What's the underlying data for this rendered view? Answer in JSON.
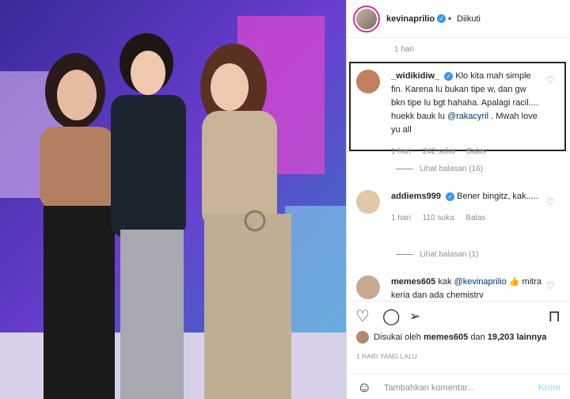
{
  "post": {
    "username": "kevinaprilio",
    "follow_status": "Diikuti",
    "dot": "•",
    "time_ago": "1 hari"
  },
  "comments": [
    {
      "username": "_widikidiw_",
      "text_before": "Klo kita mah simple fin. Karena lu bukan tipe w, dan gw bkn tipe lu bgt hahaha. Apalagi racil.... huekk bauk lu ",
      "mention": "@rakacyril",
      "text_after": " . Mwah love yu all",
      "time": "1 hari",
      "likes": "242 suka",
      "reply": "Balas",
      "view_replies": "Lihat balasan (16)"
    },
    {
      "username": "addiems999",
      "text_before": "Bener bingitz, kak.....",
      "time": "1 hari",
      "likes": "110 suka",
      "reply": "Balas",
      "view_replies": "Lihat balasan (1)"
    },
    {
      "username": "memes605",
      "text_before": "kak ",
      "mention": "@kevinaprilio",
      "text_after": " 👍 mitra keria dan ada chemistrv"
    }
  ],
  "liked_by": {
    "prefix": "Disukai oleh",
    "user": "memes605",
    "conj": "dan",
    "count": "19,203 lainnya"
  },
  "date": "1 HARI YANG LALU",
  "add_comment": {
    "placeholder": "Tambahkan komentar...",
    "send": "Kirim"
  },
  "icons": [
    "heart-icon",
    "comment-icon",
    "share-icon",
    "bookmark-icon",
    "smile-icon"
  ],
  "colors": {
    "verified": "#3897f0",
    "mention": "#00376b",
    "send_disabled": "#b2dffc"
  }
}
